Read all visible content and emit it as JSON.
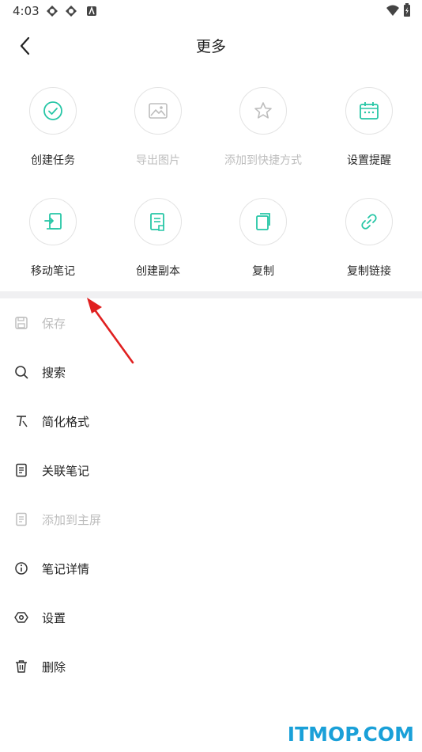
{
  "status_bar": {
    "time": "4:03"
  },
  "header": {
    "title": "更多"
  },
  "grid": [
    {
      "label": "创建任务",
      "enabled": true
    },
    {
      "label": "导出图片",
      "enabled": false
    },
    {
      "label": "添加到快捷方式",
      "enabled": false
    },
    {
      "label": "设置提醒",
      "enabled": true
    },
    {
      "label": "移动笔记",
      "enabled": true
    },
    {
      "label": "创建副本",
      "enabled": true
    },
    {
      "label": "复制",
      "enabled": true
    },
    {
      "label": "复制链接",
      "enabled": true
    }
  ],
  "list": [
    {
      "label": "保存",
      "enabled": false
    },
    {
      "label": "搜索",
      "enabled": true
    },
    {
      "label": "简化格式",
      "enabled": true
    },
    {
      "label": "关联笔记",
      "enabled": true
    },
    {
      "label": "添加到主屏",
      "enabled": false
    },
    {
      "label": "笔记详情",
      "enabled": true
    },
    {
      "label": "设置",
      "enabled": true
    },
    {
      "label": "删除",
      "enabled": true
    }
  ],
  "colors": {
    "accent": "#26c6a6",
    "disabled": "#bdbdbd",
    "annotation": "#e02020"
  },
  "watermark": "ITMOP.COM"
}
